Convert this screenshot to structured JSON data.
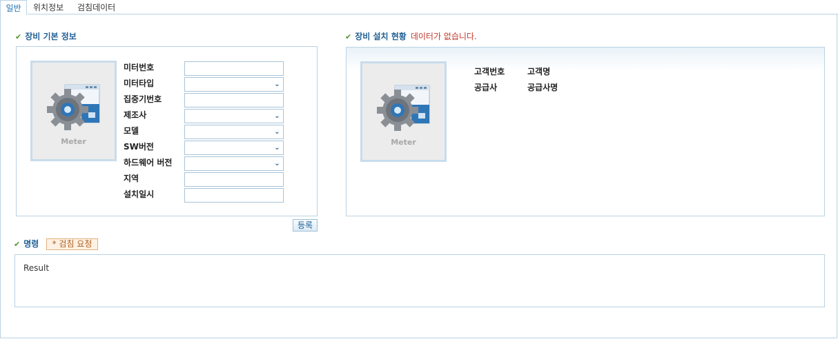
{
  "tabs": [
    {
      "label": "일반",
      "active": true
    },
    {
      "label": "위치정보",
      "active": false
    },
    {
      "label": "검침데이터",
      "active": false
    }
  ],
  "basic_info": {
    "title": "장비 기본 정보",
    "image_caption": "Meter",
    "fields": [
      {
        "label": "미터번호",
        "type": "input",
        "value": ""
      },
      {
        "label": "미터타입",
        "type": "select",
        "value": ""
      },
      {
        "label": "집중기번호",
        "type": "input",
        "value": ""
      },
      {
        "label": "제조사",
        "type": "select",
        "value": ""
      },
      {
        "label": "모델",
        "type": "select",
        "value": ""
      },
      {
        "label": "SW버전",
        "type": "select",
        "value": ""
      },
      {
        "label": "하드웨어 버전",
        "type": "select",
        "value": ""
      },
      {
        "label": "지역",
        "type": "input",
        "value": ""
      },
      {
        "label": "설치일시",
        "type": "input",
        "value": ""
      }
    ],
    "register_button": "등록"
  },
  "install_status": {
    "title": "장비 설치 현황",
    "no_data": "데이터가 없습니다.",
    "image_caption": "Meter",
    "rows": [
      {
        "label": "고객번호",
        "value": "고객명"
      },
      {
        "label": "공급사",
        "value": "공급사명"
      }
    ]
  },
  "command": {
    "title": "명령",
    "request_button": "* 검침 요청",
    "result_text": "Result"
  },
  "colors": {
    "accent": "#1f5f94",
    "border": "#b9d2e3",
    "check": "#4c9a2a",
    "warning": "#c0392b"
  }
}
